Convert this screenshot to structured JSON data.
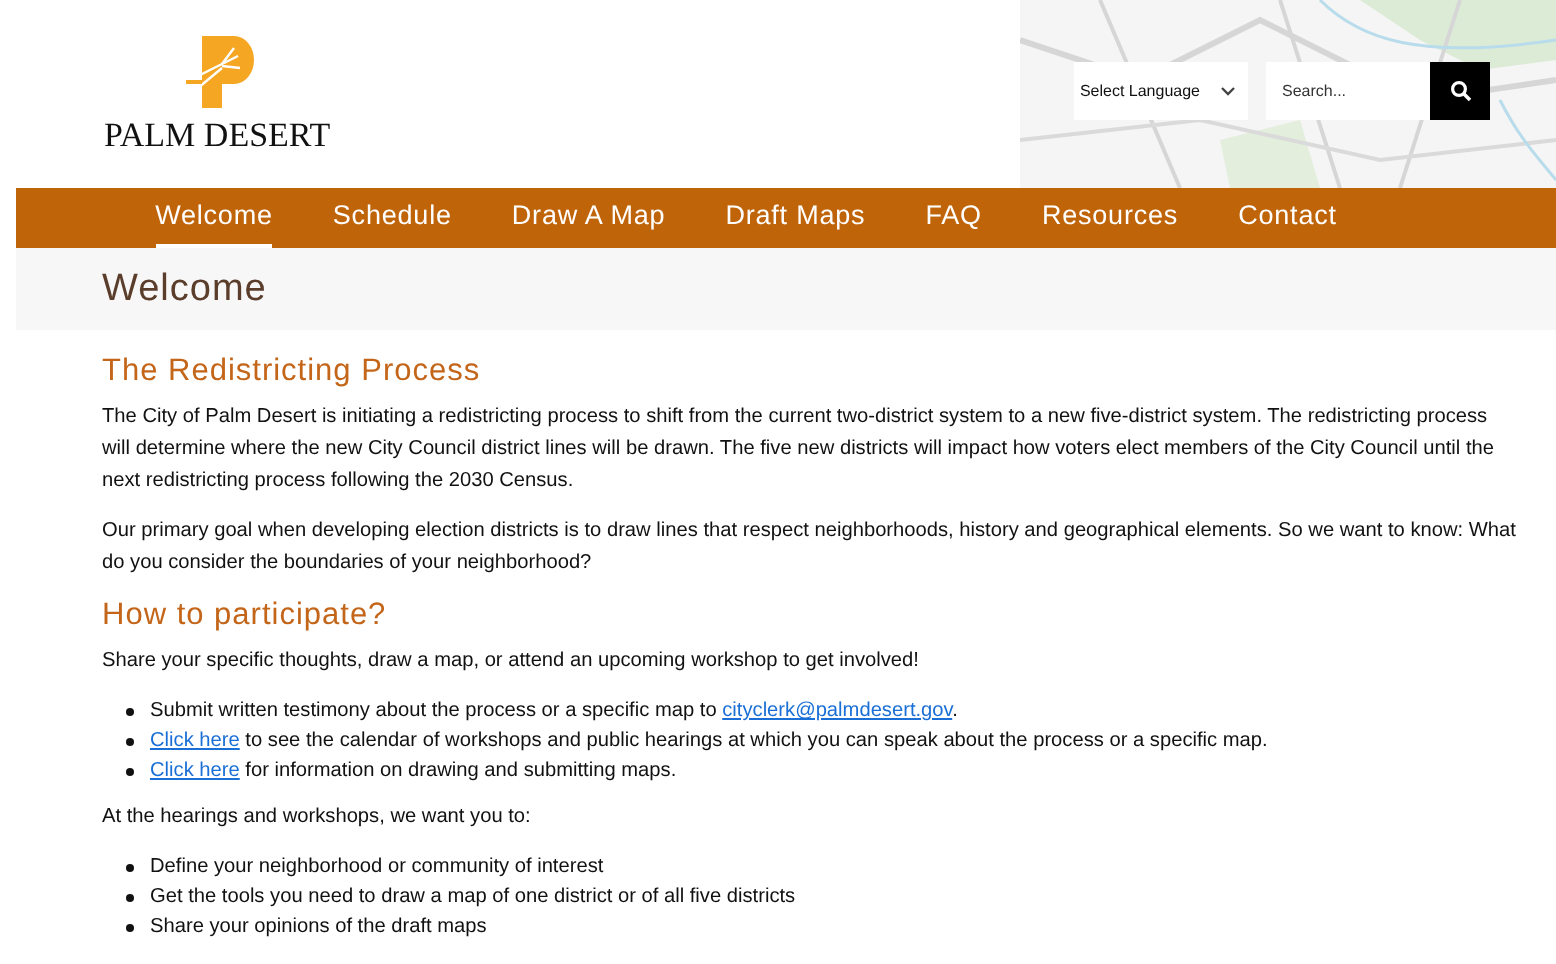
{
  "header": {
    "logo_text": "PALM DESERT",
    "language_select": {
      "value": "Select Language"
    },
    "search": {
      "placeholder": "Search..."
    }
  },
  "nav": [
    {
      "label": "Welcome",
      "selected": true
    },
    {
      "label": "Schedule",
      "selected": false
    },
    {
      "label": "Draw A Map",
      "selected": false
    },
    {
      "label": "Draft Maps",
      "selected": false
    },
    {
      "label": "FAQ",
      "selected": false
    },
    {
      "label": "Resources",
      "selected": false
    },
    {
      "label": "Contact",
      "selected": false
    }
  ],
  "page_title": "Welcome",
  "sections": [
    {
      "heading": "The Redistricting Process",
      "blocks": [
        {
          "kind": "paragraph",
          "text": "The City of Palm Desert is initiating a redistricting process to shift from the current two-district system to a new five-district system. The redistricting process will determine where the new City Council district lines will be drawn. The five new districts will impact how voters elect members of the City Council until the next redistricting process following the 2030 Census."
        },
        {
          "kind": "paragraph",
          "text": "Our primary goal when developing election districts is to draw lines that respect neighborhoods, history and geographical elements. So we want to know: What do you consider the boundaries of your neighborhood?"
        }
      ]
    },
    {
      "heading": "How to participate?",
      "blocks": [
        {
          "kind": "paragraph",
          "text": "Share your specific thoughts, draw a map, or attend an upcoming workshop to get involved!"
        },
        {
          "kind": "list",
          "items": [
            [
              {
                "kind": "text",
                "text": "Submit written testimony about the process or a specific map to "
              },
              {
                "kind": "link",
                "text": "cityclerk@palmdesert.gov"
              },
              {
                "kind": "text",
                "text": "."
              }
            ],
            [
              {
                "kind": "link",
                "text": "Click here"
              },
              {
                "kind": "text",
                "text": " to see the calendar of workshops and public hearings at which you can speak about the process or a specific map."
              }
            ],
            [
              {
                "kind": "link",
                "text": "Click here"
              },
              {
                "kind": "text",
                "text": " for information on drawing and submitting maps."
              }
            ]
          ]
        },
        {
          "kind": "paragraph",
          "text": "At the hearings and workshops, we want you to:"
        },
        {
          "kind": "list",
          "items": [
            [
              {
                "kind": "text",
                "text": "Define your neighborhood or community of interest"
              }
            ],
            [
              {
                "kind": "text",
                "text": "Get the tools you need to draw a map of one district or of all five districts"
              }
            ],
            [
              {
                "kind": "text",
                "text": "Share your opinions of the draft maps"
              }
            ]
          ]
        }
      ]
    }
  ]
}
